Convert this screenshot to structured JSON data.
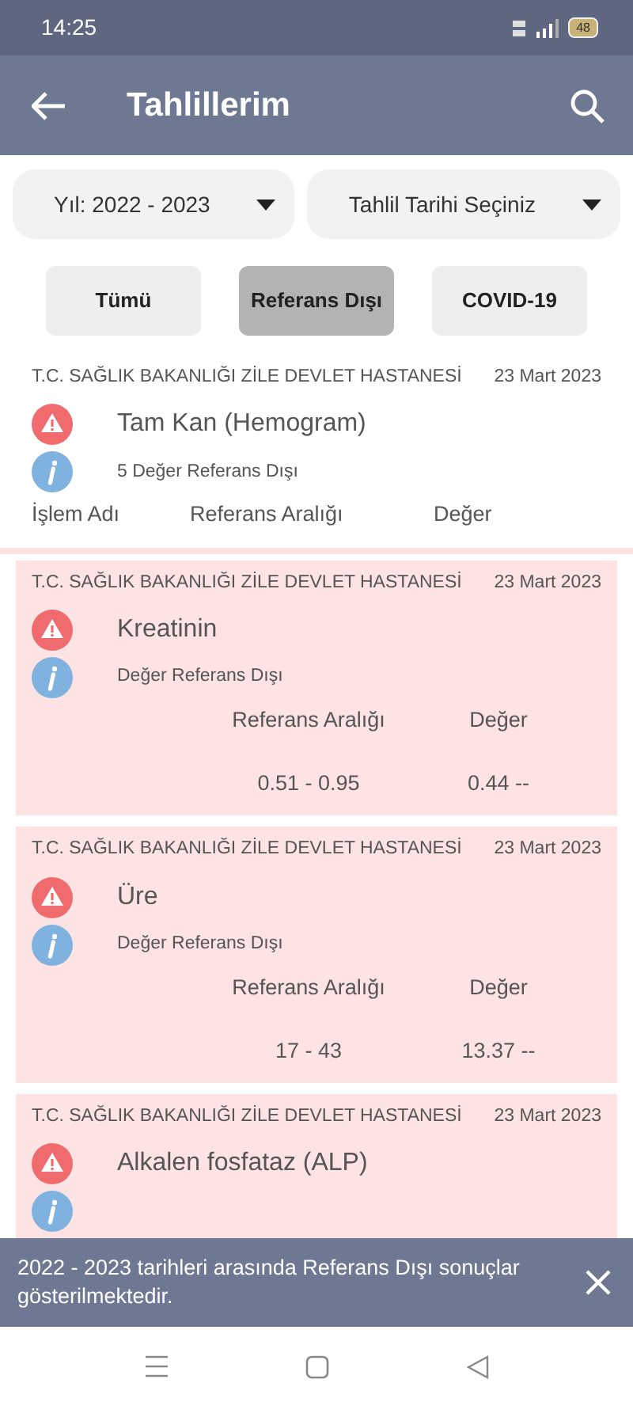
{
  "status_bar": {
    "time": "14:25",
    "battery": "48"
  },
  "app_bar": {
    "title": "Tahlillerim"
  },
  "filters": [
    {
      "label": "Yıl: 2022 - 2023"
    },
    {
      "label": "Tahlil Tarihi Seçiniz"
    }
  ],
  "tabs": [
    {
      "label": "Tümü",
      "selected": false
    },
    {
      "label": "Referans Dışı",
      "selected": true
    },
    {
      "label": "COVID-19",
      "selected": false
    }
  ],
  "group": {
    "hospital": "T.C. SAĞLIK BAKANLIĞI ZİLE DEVLET HASTANESİ",
    "date": "23 Mart 2023",
    "title": "Tam Kan (Hemogram)",
    "subtitle": "5 Değer Referans Dışı",
    "columns": [
      "İşlem Adı",
      "Referans Aralığı",
      "Değer"
    ]
  },
  "results": [
    {
      "hospital": "T.C. SAĞLIK BAKANLIĞI ZİLE DEVLET HASTANESİ",
      "date": "23 Mart 2023",
      "title": "Kreatinin",
      "subtitle": "Değer Referans Dışı",
      "columns": [
        "Referans Aralığı",
        "Değer"
      ],
      "values": [
        "0.51 - 0.95",
        "0.44 --"
      ]
    },
    {
      "hospital": "T.C. SAĞLIK BAKANLIĞI ZİLE DEVLET HASTANESİ",
      "date": "23 Mart 2023",
      "title": "Üre",
      "subtitle": "Değer Referans Dışı",
      "columns": [
        "Referans Aralığı",
        "Değer"
      ],
      "values": [
        "17 - 43",
        "13.37 --"
      ]
    },
    {
      "hospital": "T.C. SAĞLIK BAKANLIĞI ZİLE DEVLET HASTANESİ",
      "date": "23 Mart 2023",
      "title": "Alkalen fosfataz (ALP)"
    }
  ],
  "snackbar": {
    "message": "2022 - 2023 tarihleri arasında Referans Dışı sonuçlar gösterilmektedir."
  }
}
